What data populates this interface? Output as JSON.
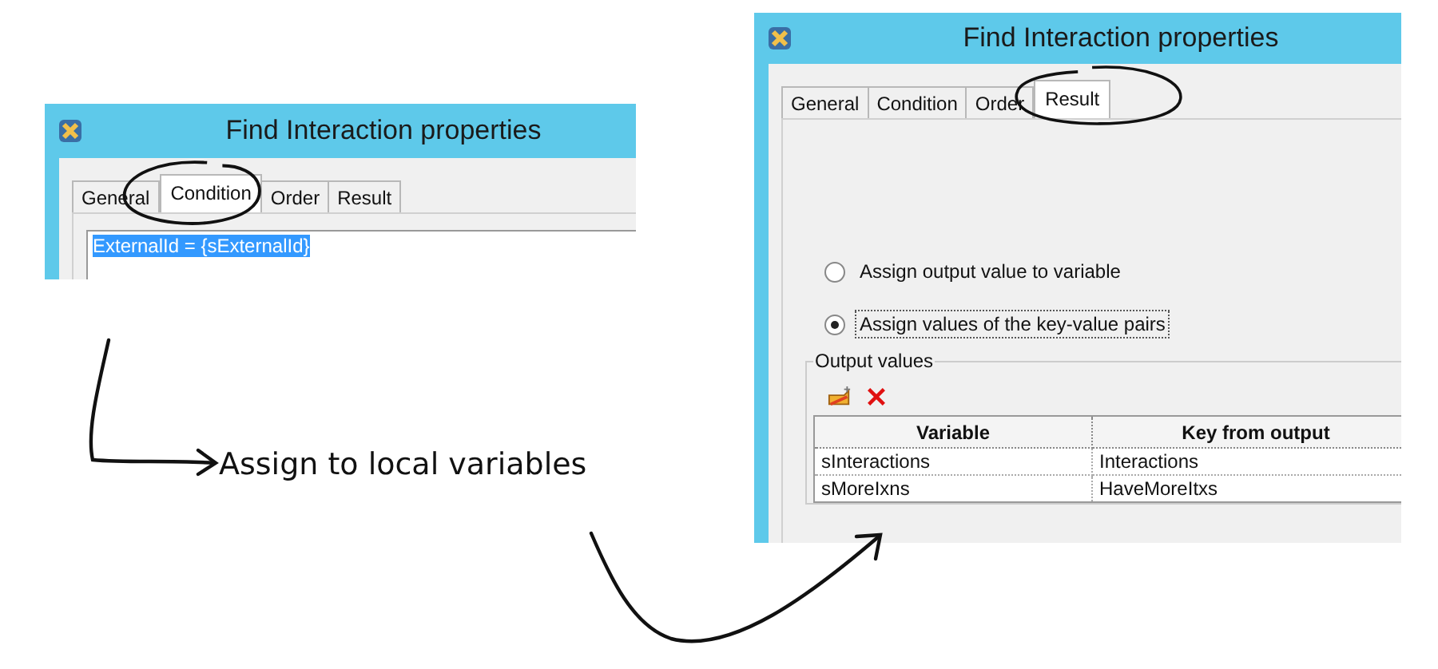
{
  "left_window": {
    "title": "Find Interaction properties",
    "tabs": [
      {
        "label": "General",
        "selected": false
      },
      {
        "label": "Condition",
        "selected": true
      },
      {
        "label": "Order",
        "selected": false
      },
      {
        "label": "Result",
        "selected": false
      }
    ],
    "condition_text": "ExternalId = {sExternalId}"
  },
  "annotation": {
    "label": "Assign to local variables"
  },
  "right_window": {
    "title": "Find Interaction properties",
    "tabs": [
      {
        "label": "General",
        "selected": false
      },
      {
        "label": "Condition",
        "selected": false
      },
      {
        "label": "Order",
        "selected": false
      },
      {
        "label": "Result",
        "selected": true
      }
    ],
    "options": [
      {
        "label": "Assign output value to variable",
        "selected": false
      },
      {
        "label": "Assign values of the key-value pairs",
        "selected": true
      }
    ],
    "output_values": {
      "title": "Output values",
      "columns": [
        "Variable",
        "Key from output"
      ],
      "rows": [
        [
          "sInteractions",
          "Interactions"
        ],
        [
          "sMoreIxns",
          "HaveMoreItxs"
        ]
      ]
    }
  }
}
